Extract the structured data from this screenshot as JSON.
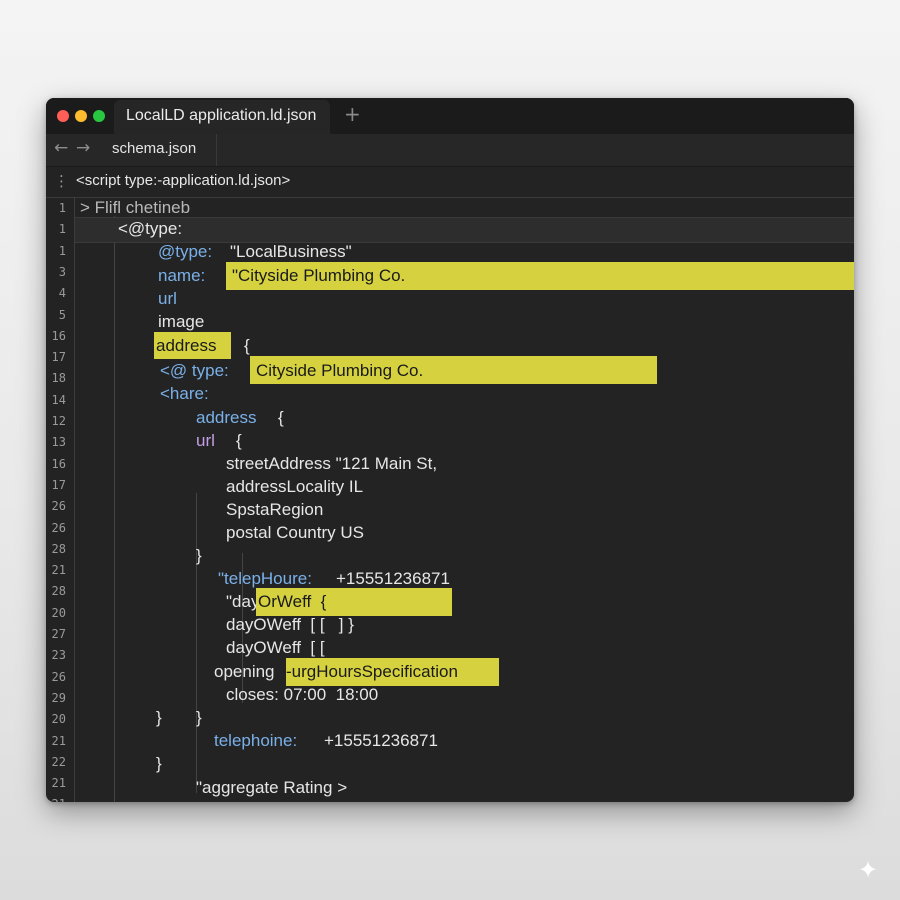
{
  "window": {
    "tab_title": "LocalLD application.ld.json",
    "new_tab": "+",
    "file_tab": "schema.json",
    "script_line": "<script type:-application.ld.json>"
  },
  "line_numbers": [
    "1",
    "1",
    "1",
    "3",
    "4",
    "5",
    "16",
    "17",
    "18",
    "14",
    "12",
    "13",
    "16",
    "17",
    "26",
    "26",
    "28",
    "21",
    "28",
    "20",
    "27",
    "23",
    "26",
    "29",
    "20",
    "21",
    "22",
    "21",
    "21"
  ],
  "code": {
    "l0": "> Flifl chetineb",
    "l1": "<@type:",
    "l2_key": "@type:",
    "l2_val": "\"LocalBusiness\"",
    "l3_key": "name:",
    "l3_val": "\"Cityside Plumbing Co.",
    "l4": "url",
    "l5": "image",
    "l6_key": "address",
    "l6_brace": "{",
    "l7_key": "<@ type:",
    "l7_val": "Cityside Plumbing Co.",
    "l8": "<hare:",
    "l9_key": "address",
    "l9_brace": "{",
    "l10_key": "url",
    "l10_brace": "{",
    "l11": "streetAddress \"121 Main St,",
    "l12": "addressLocality IL",
    "l13": "SpstaRegion",
    "l14": "postal Country US",
    "l15": "}",
    "l16_key": "\"telepHoure:",
    "l16_val": "+15551236871",
    "l17_pre": "\"day",
    "l17_hl": "OrWeff  {",
    "l18": "dayOWeff  [ [   ] }",
    "l19": "dayOWeff  [ [",
    "l20_pre": "opening",
    "l20_hl": "-urgHoursSpecification",
    "l21": "closes: 07:00  18:00",
    "l22_a": "}",
    "l22_b": "}",
    "l23_key": "telephoine:",
    "l23_val": "+15551236871",
    "l24": "}",
    "l25": "\"aggregate Rating >"
  },
  "icons": {
    "back": "arrow-left-icon",
    "forward": "arrow-right-icon",
    "kebab": "kebab-menu-icon",
    "sparkle": "sparkle-icon"
  },
  "colors": {
    "editor_bg": "#232323",
    "highlight": "#d6d23f",
    "keyword": "#7ab0e8",
    "purple_key": "#c49fe6"
  }
}
